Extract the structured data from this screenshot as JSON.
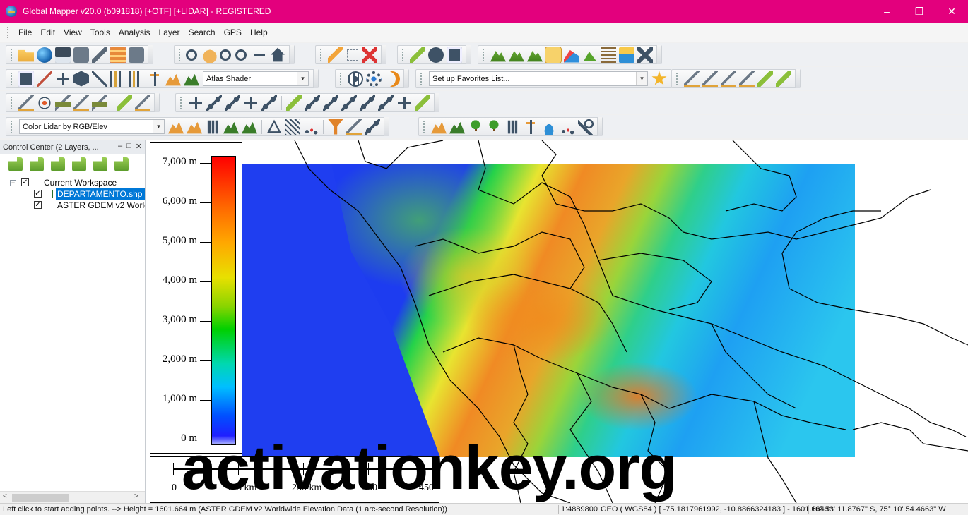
{
  "window": {
    "title": "Global Mapper v20.0 (b091818) [+OTF] [+LIDAR] - REGISTERED",
    "controls": {
      "minimize": "–",
      "restore": "❒",
      "close": "✕"
    }
  },
  "menu": [
    "File",
    "Edit",
    "View",
    "Tools",
    "Analysis",
    "Layer",
    "Search",
    "GPS",
    "Help"
  ],
  "toolbars": {
    "shader_combo": "Atlas Shader",
    "favorites_combo": "Set up Favorites List...",
    "lidar_color_combo": "Color Lidar by RGB/Elev",
    "combo_arrow": "▾"
  },
  "control_center": {
    "title": "Control Center (2 Layers, ...",
    "buttons": {
      "pin": "–",
      "restore": "□",
      "close": "✕"
    },
    "workspace_label": "Current Workspace",
    "layers": [
      {
        "name": "DEPARTAMENTO.shp [",
        "checked": true,
        "selected": true
      },
      {
        "name": "ASTER GDEM v2 Worldv",
        "checked": true,
        "selected": false
      }
    ],
    "scroll_left": "<",
    "scroll_right": ">"
  },
  "legend": {
    "labels": [
      "7,000 m",
      "6,000 m",
      "5,000 m",
      "4,000 m",
      "3,000 m",
      "2,000 m",
      "1,000 m",
      "0 m"
    ]
  },
  "scale_bar": {
    "labels": [
      "0",
      "125 km",
      "250 km",
      "350",
      "450"
    ]
  },
  "watermark": "activationkey.org",
  "status_bar": {
    "message": "Left click to start adding points. --> Height = 1601.664 m (ASTER GDEM v2 Worldwide Elevation Data (1 arc-second Resolution))",
    "scale": "1:4889800",
    "projection": "GEO ( WGS84 ) [ -75.1817961992, -10.8866324183 ] - 1601.664 m",
    "coords": "10° 53' 11.8767\" S, 75° 10' 54.4663\" W"
  },
  "colors": {
    "titlebar": "#e3007d",
    "selection": "#0078d7"
  }
}
